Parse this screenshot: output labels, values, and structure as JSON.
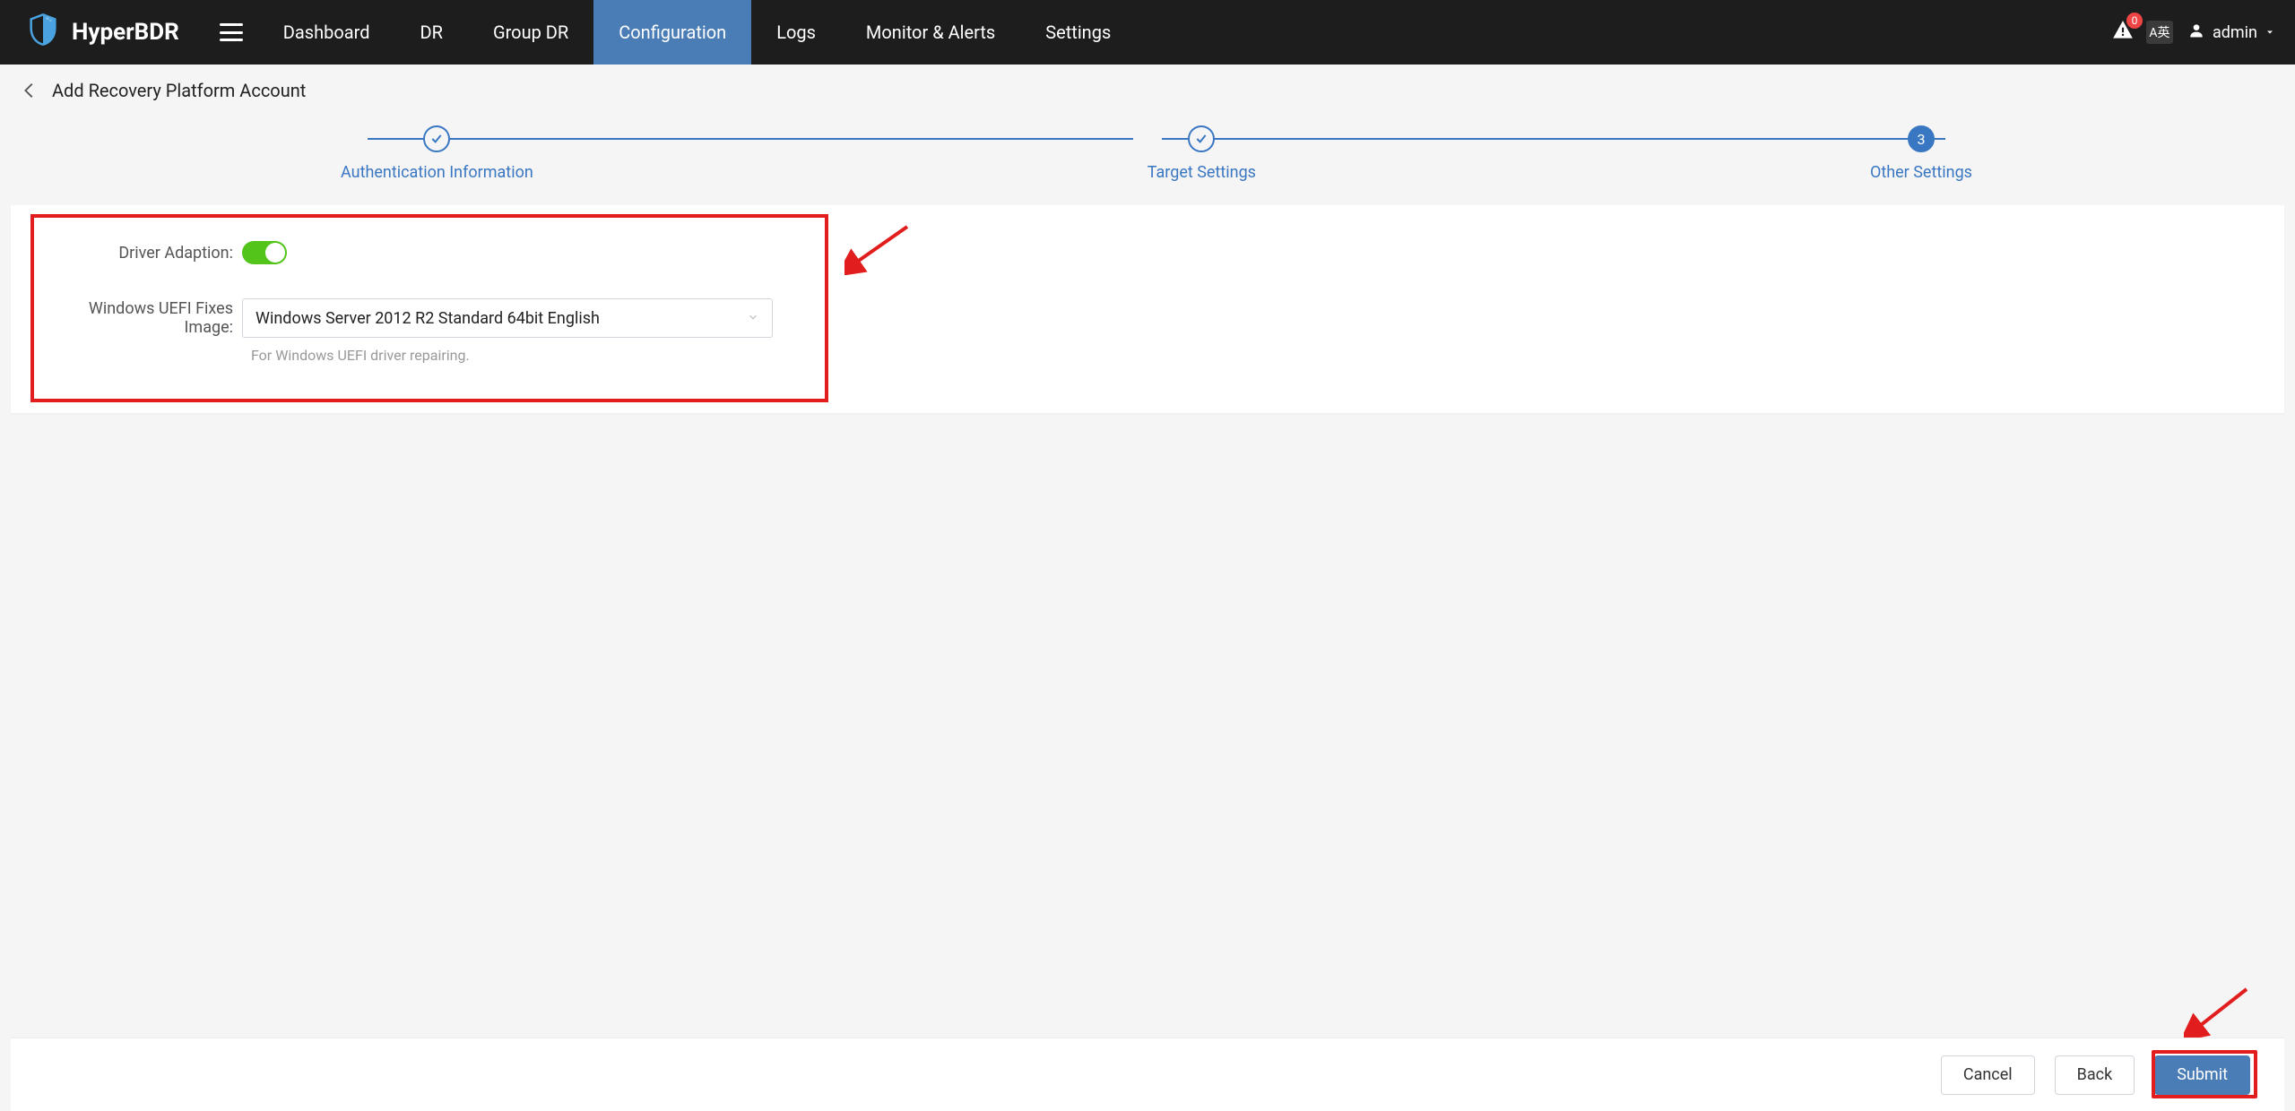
{
  "brand": {
    "name": "HyperBDR"
  },
  "nav": {
    "items": [
      {
        "label": "Dashboard",
        "active": false
      },
      {
        "label": "DR",
        "active": false
      },
      {
        "label": "Group DR",
        "active": false
      },
      {
        "label": "Configuration",
        "active": true
      },
      {
        "label": "Logs",
        "active": false
      },
      {
        "label": "Monitor & Alerts",
        "active": false
      },
      {
        "label": "Settings",
        "active": false
      }
    ]
  },
  "topRight": {
    "bell_count": "0",
    "locale_badge": "A英",
    "user": "admin"
  },
  "page": {
    "title": "Add Recovery Platform Account"
  },
  "steps": {
    "items": [
      {
        "label": "Authentication Information",
        "state": "done"
      },
      {
        "label": "Target Settings",
        "state": "done"
      },
      {
        "label": "Other Settings",
        "state": "current",
        "number": "3"
      }
    ]
  },
  "form": {
    "driver_adaption_label": "Driver Adaption:",
    "driver_adaption_on": true,
    "uefi_image_label": "Windows UEFI Fixes Image:",
    "uefi_image_value": "Windows Server 2012 R2 Standard 64bit English",
    "uefi_image_help": "For Windows UEFI driver repairing."
  },
  "footer": {
    "cancel": "Cancel",
    "back": "Back",
    "submit": "Submit"
  }
}
